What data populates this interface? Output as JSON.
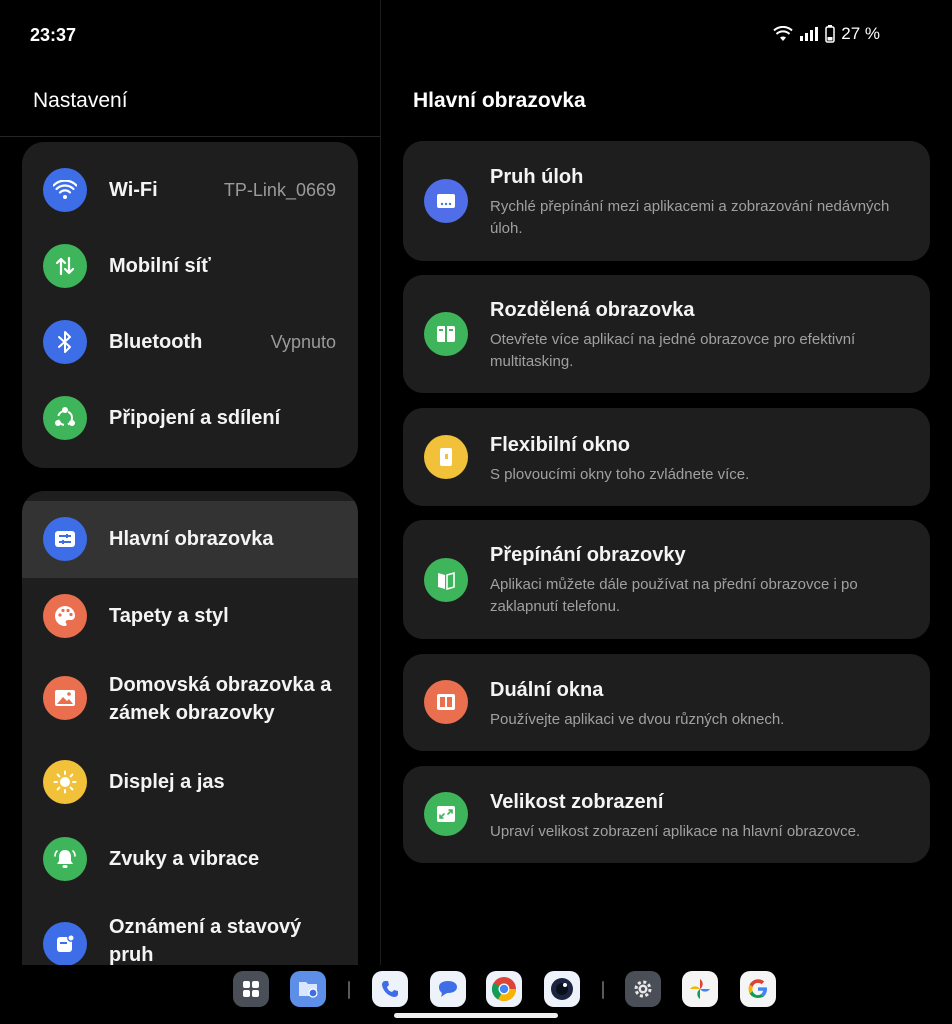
{
  "status": {
    "time": "23:37",
    "battery": "27 %"
  },
  "left": {
    "title": "Nastavení",
    "group1": [
      {
        "label": "Wi-Fi",
        "value": "TP-Link_0669",
        "icon": "wifi-icon",
        "color": "#3d6ee8"
      },
      {
        "label": "Mobilní síť",
        "icon": "mobile-data-icon",
        "color": "#3eb55a"
      },
      {
        "label": "Bluetooth",
        "value": "Vypnuto",
        "icon": "bluetooth-icon",
        "color": "#3d6ee8"
      },
      {
        "label": "Připojení a sdílení",
        "icon": "connection-sharing-icon",
        "color": "#3eb55a"
      }
    ],
    "group2": [
      {
        "label": "Hlavní obrazovka",
        "icon": "main-screen-icon",
        "color": "#3d6ee8"
      },
      {
        "label": "Tapety a styl",
        "icon": "palette-icon",
        "color": "#ea6f4e"
      },
      {
        "label": "Domovská obrazovka a zámek obrazovky",
        "line1": "Domovská obrazovka a",
        "line2": "zámek obrazovky",
        "icon": "image-icon",
        "color": "#ea6f4e"
      },
      {
        "label": "Displej a jas",
        "icon": "sun-icon",
        "color": "#f2c13a"
      },
      {
        "label": "Zvuky a vibrace",
        "icon": "bell-icon",
        "color": "#3eb55a"
      },
      {
        "label": "Oznámení a stavový pruh",
        "line1": "Oznámení a stavový",
        "line2": "pruh",
        "icon": "notification-icon",
        "color": "#3d6ee8"
      }
    ]
  },
  "right": {
    "title": "Hlavní obrazovka",
    "cards": [
      {
        "title": "Pruh úloh",
        "desc": "Rychlé přepínání mezi aplikacemi a zobrazování nedávných úloh.",
        "icon": "taskbar-icon",
        "color": "#4f6ee8"
      },
      {
        "title": "Rozdělená obrazovka",
        "desc": "Otevřete více aplikací na jedné obrazovce pro efektivní multitasking.",
        "icon": "split-screen-icon",
        "color": "#3eb55a"
      },
      {
        "title": "Flexibilní okno",
        "desc": "S plovoucími okny toho zvládnete více.",
        "icon": "flexible-window-icon",
        "color": "#f2c13a"
      },
      {
        "title": "Přepínání obrazovky",
        "desc": "Aplikaci můžete dále používat na přední obrazovce i po zaklapnutí telefonu.",
        "icon": "screen-switch-icon",
        "color": "#3eb55a"
      },
      {
        "title": "Duální okna",
        "desc": "Používejte aplikaci ve dvou různých oknech.",
        "icon": "dual-window-icon",
        "color": "#ea6f4e"
      },
      {
        "title": "Velikost zobrazení",
        "desc": "Upraví velikost zobrazení aplikace na hlavní obrazovce.",
        "icon": "display-size-icon",
        "color": "#3eb55a"
      }
    ]
  },
  "dock": [
    "app-drawer-icon",
    "files-icon",
    "phone-icon",
    "messages-icon",
    "chrome-icon",
    "camera-icon",
    "settings-icon",
    "photos-icon",
    "google-icon"
  ]
}
